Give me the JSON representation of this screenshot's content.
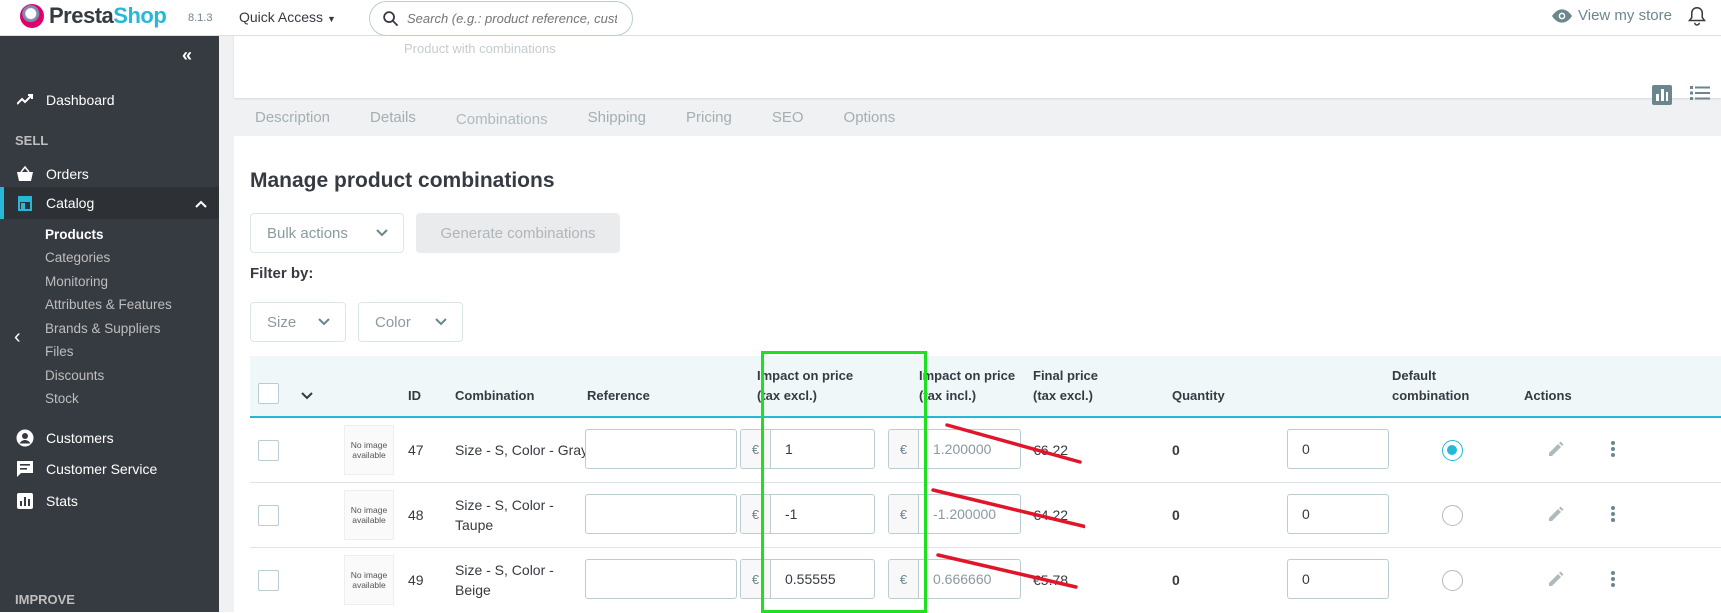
{
  "header": {
    "brand_prefix": "Presta",
    "brand_suffix": "Shop",
    "version": "8.1.3",
    "quick_access": "Quick Access",
    "search_placeholder": "Search (e.g.: product reference, custon",
    "view_store": "View my store"
  },
  "sidebar": {
    "dashboard": "Dashboard",
    "sell_section": "SELL",
    "orders": "Orders",
    "catalog": "Catalog",
    "catalog_sub": [
      "Products",
      "Categories",
      "Monitoring",
      "Attributes & Features",
      "Brands & Suppliers",
      "Files",
      "Discounts",
      "Stock"
    ],
    "customers": "Customers",
    "customer_service": "Customer Service",
    "stats": "Stats",
    "improve_section": "IMPROVE"
  },
  "product": {
    "prev_card_text": "Product with combinations"
  },
  "tabs": [
    "Description",
    "Details",
    "Combinations",
    "Shipping",
    "Pricing",
    "SEO",
    "Options"
  ],
  "active_tab": "Combinations",
  "combinations": {
    "title": "Manage product combinations",
    "bulk_actions": "Bulk actions",
    "generate": "Generate combinations",
    "filter_by": "Filter by:",
    "filter_size": "Size",
    "filter_color": "Color",
    "columns": {
      "id": "ID",
      "combination": "Combination",
      "reference": "Reference",
      "impact_excl_line1": "Impact on price",
      "impact_excl_line2": "(tax excl.)",
      "impact_incl_line1": "Impact on price",
      "impact_incl_line2": "(tax incl.)",
      "final_line1": "Final price",
      "final_line2": "(tax excl.)",
      "quantity": "Quantity",
      "default_line1": "Default",
      "default_line2": "combination",
      "actions": "Actions"
    },
    "no_image": "No image available",
    "currency": "€",
    "rows": [
      {
        "id": "47",
        "combination": "Size - S, Color - Gray",
        "reference": "",
        "impact_excl": "1",
        "impact_incl": "1.200000",
        "final_price": "€6.22",
        "quantity": "0",
        "qty_input": "0",
        "is_default": true
      },
      {
        "id": "48",
        "combination": "Size - S, Color - Taupe",
        "reference": "",
        "impact_excl": "-1",
        "impact_incl": "-1.200000",
        "final_price": "€4.22",
        "quantity": "0",
        "qty_input": "0",
        "is_default": false
      },
      {
        "id": "49",
        "combination": "Size - S, Color - Beige",
        "reference": "",
        "impact_excl": "0.55555",
        "impact_incl": "0.666660",
        "final_price": "€5.78",
        "quantity": "0",
        "qty_input": "0",
        "is_default": false
      }
    ]
  },
  "colors": {
    "accent": "#25b9d7",
    "sidebar_bg": "#363a41",
    "highlight_box": "#1ee01e",
    "strike_line": "#e0152a"
  }
}
